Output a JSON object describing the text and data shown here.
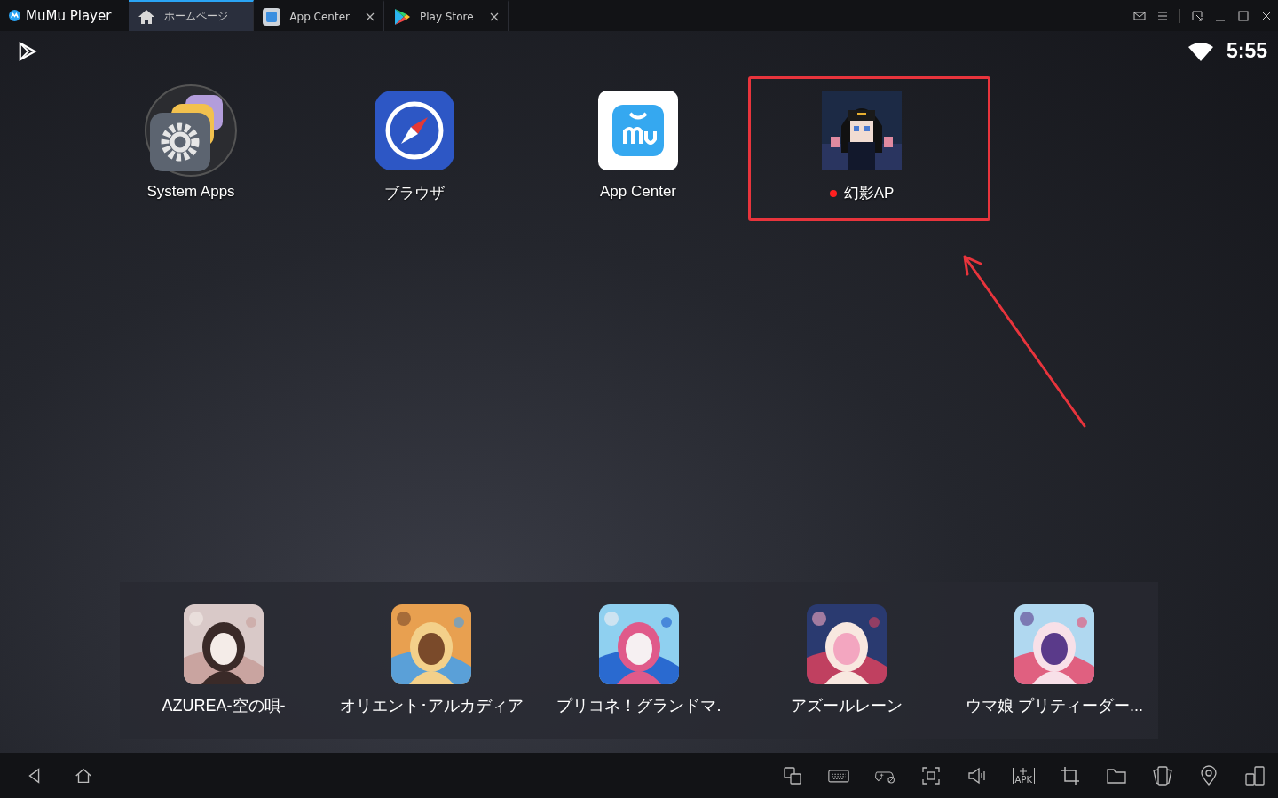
{
  "title_bar": {
    "app_name": "MuMu Player",
    "tabs": [
      {
        "label": "ホームページ",
        "kind": "home",
        "selected": true,
        "closable": false
      },
      {
        "label": "App Center",
        "kind": "appcenter",
        "selected": false,
        "closable": true
      },
      {
        "label": "Play Store",
        "kind": "playstore",
        "selected": false,
        "closable": true
      }
    ]
  },
  "status_bar": {
    "time": "5:55"
  },
  "desktop": [
    {
      "label": "System Apps",
      "kind": "system",
      "new": false,
      "highlighted": false
    },
    {
      "label": "ブラウザ",
      "kind": "browser",
      "new": false,
      "highlighted": false
    },
    {
      "label": "App Center",
      "kind": "appcenter",
      "new": false,
      "highlighted": false
    },
    {
      "label": "幻影AP",
      "kind": "picture",
      "new": true,
      "highlighted": true
    }
  ],
  "dock": [
    {
      "label": "AZUREA-空の唄-"
    },
    {
      "label": "オリエント･アルカディア"
    },
    {
      "label": "プリコネ！グランドマ."
    },
    {
      "label": "アズールレーン"
    },
    {
      "label": "ウマ娘 プリティーダー..."
    }
  ],
  "toolbar": {
    "apk_label": "APK"
  }
}
